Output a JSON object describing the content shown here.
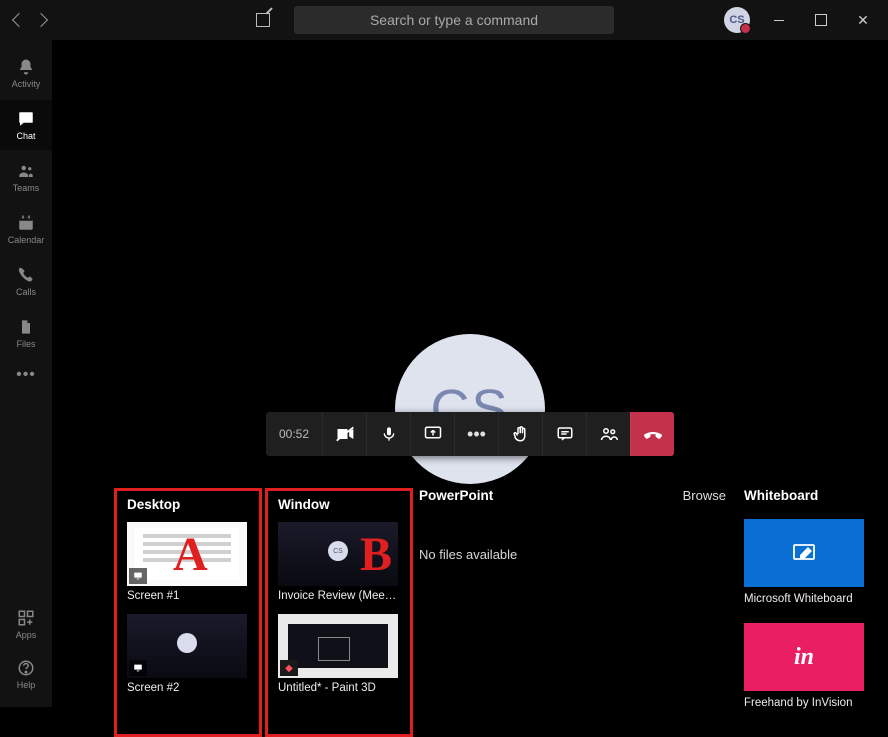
{
  "title_bar": {
    "search_placeholder": "Search or type a command",
    "avatar_initials": "CS"
  },
  "rail": {
    "items": [
      {
        "label": "Activity",
        "icon": "bell"
      },
      {
        "label": "Chat",
        "icon": "chat",
        "active": true
      },
      {
        "label": "Teams",
        "icon": "teams"
      },
      {
        "label": "Calendar",
        "icon": "calendar"
      },
      {
        "label": "Calls",
        "icon": "phone"
      },
      {
        "label": "Files",
        "icon": "files"
      }
    ],
    "bottom": [
      {
        "label": "Apps",
        "icon": "apps"
      },
      {
        "label": "Help",
        "icon": "help"
      }
    ]
  },
  "call": {
    "avatar_initials": "CS",
    "timer": "00:52"
  },
  "share": {
    "desktop": {
      "title": "Desktop",
      "items": [
        {
          "label": "Screen #1"
        },
        {
          "label": "Screen #2"
        }
      ],
      "annotation": "A"
    },
    "window": {
      "title": "Window",
      "items": [
        {
          "label": "Invoice Review (Meeting)..."
        },
        {
          "label": "Untitled* - Paint 3D"
        }
      ],
      "annotation": "B"
    },
    "powerpoint": {
      "title": "PowerPoint",
      "browse": "Browse",
      "empty_text": "No files available"
    },
    "whiteboard": {
      "title": "Whiteboard",
      "items": [
        {
          "label": "Microsoft Whiteboard",
          "color": "blue"
        },
        {
          "label": "Freehand by InVision",
          "color": "pink"
        }
      ]
    }
  }
}
